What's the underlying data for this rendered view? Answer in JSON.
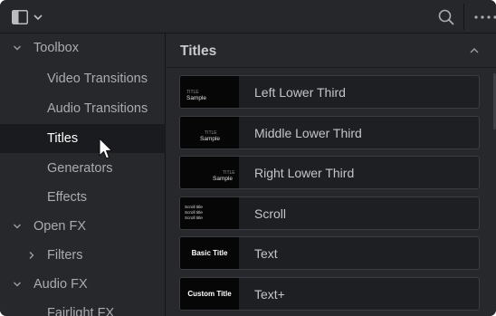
{
  "topbar": {
    "panel_toggle_icon": "sidebar-panel-icon",
    "dropdown_icon": "chevron-down-icon",
    "search_icon": "search-icon",
    "more_icon": "more-horizontal-icon"
  },
  "sidebar": {
    "items": [
      {
        "label": "Toolbox",
        "expanded": true,
        "level": 0
      },
      {
        "label": "Video Transitions",
        "level": 1
      },
      {
        "label": "Audio Transitions",
        "level": 1
      },
      {
        "label": "Titles",
        "level": 1,
        "selected": true
      },
      {
        "label": "Generators",
        "level": 1
      },
      {
        "label": "Effects",
        "level": 1
      },
      {
        "label": "Open FX",
        "expanded": true,
        "level": 0
      },
      {
        "label": "Filters",
        "expanded": false,
        "level": 1
      },
      {
        "label": "Audio FX",
        "expanded": true,
        "level": 0
      },
      {
        "label": "Fairlight FX",
        "level": 1
      }
    ]
  },
  "main": {
    "section_title": "Titles",
    "collapse_icon": "chevron-up-icon",
    "rows": [
      {
        "label": "Left Lower Third",
        "thumb_small": "TITLE",
        "thumb_sample": "Sample"
      },
      {
        "label": "Middle Lower Third",
        "thumb_small": "TITLE",
        "thumb_sample": "Sample"
      },
      {
        "label": "Right Lower Third",
        "thumb_small": "TITLE",
        "thumb_sample": "Sample"
      },
      {
        "label": "Scroll",
        "thumb_lines": [
          "Scroll title",
          "Scroll title",
          "Scroll title"
        ]
      },
      {
        "label": "Text",
        "thumb_text": "Basic Title"
      },
      {
        "label": "Text+",
        "thumb_text": "Custom Title"
      }
    ]
  },
  "colors": {
    "background": "#26272b",
    "selected_row": "#1a1b1e",
    "text_muted": "#a9acb1",
    "text_selected": "#ffffff"
  }
}
